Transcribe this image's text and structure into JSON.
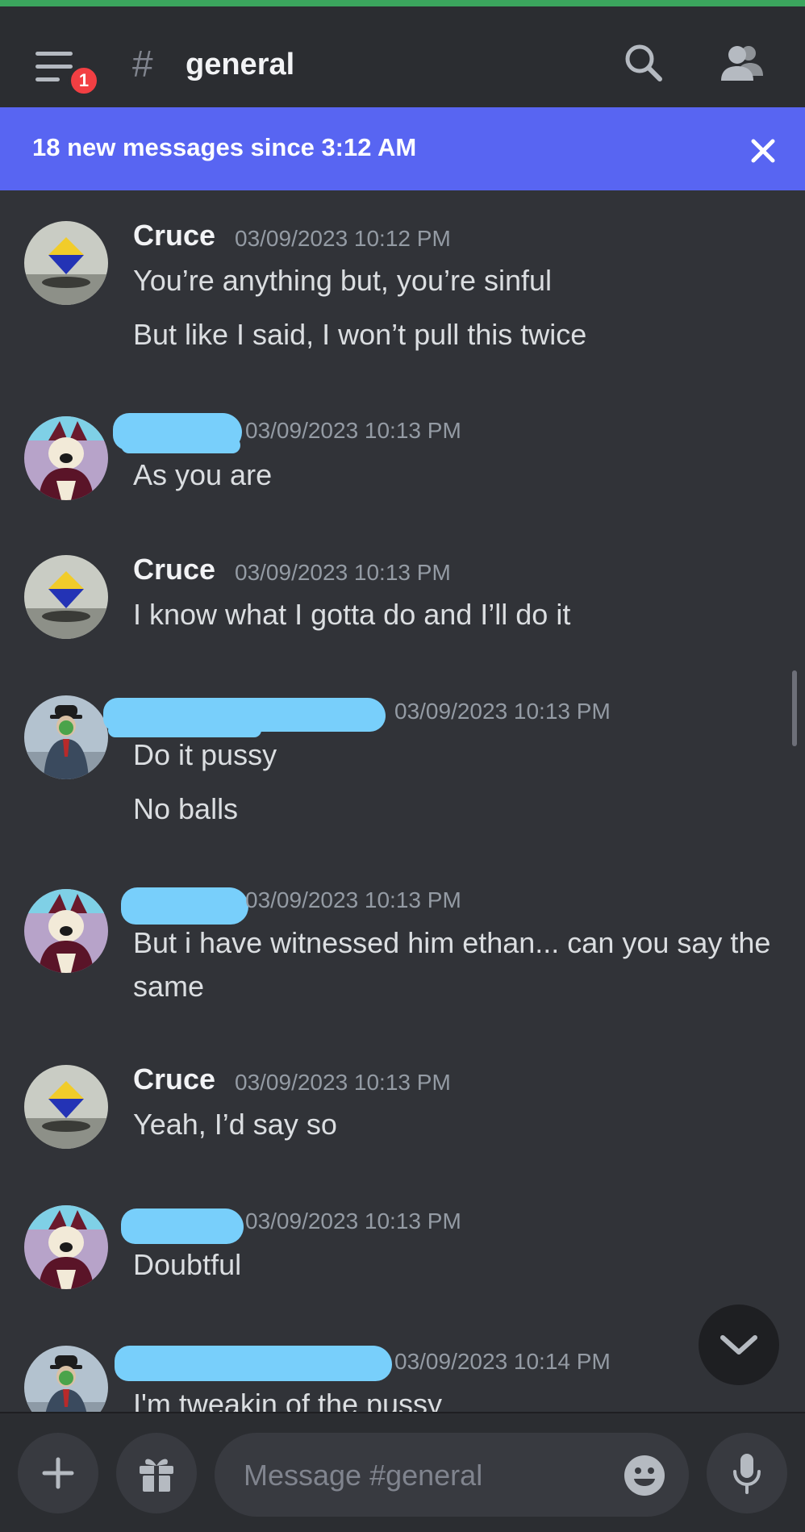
{
  "header": {
    "notification_count": "1",
    "channel_hash": "#",
    "channel_name": "general"
  },
  "banner": {
    "text": "18 new messages since 3:12 AM"
  },
  "messages": [
    {
      "author": "Cruce",
      "timestamp": "03/09/2023 10:12 PM",
      "lines": [
        "You’re anything but, you’re sinful",
        "But like I said, I won’t pull this twice"
      ]
    },
    {
      "author": "",
      "timestamp": "03/09/2023 10:13 PM",
      "lines": [
        "As you are"
      ]
    },
    {
      "author": "Cruce",
      "timestamp": "03/09/2023 10:13 PM",
      "lines": [
        "I know what I gotta do and I’ll do it"
      ]
    },
    {
      "author": "",
      "timestamp": "03/09/2023 10:13 PM",
      "lines": [
        "Do it pussy",
        "No balls"
      ]
    },
    {
      "author": "",
      "timestamp": "03/09/2023 10:13 PM",
      "lines": [
        "But i have witnessed him ethan... can you say the same"
      ]
    },
    {
      "author": "Cruce",
      "timestamp": "03/09/2023 10:13 PM",
      "lines": [
        "Yeah, I’d say so"
      ]
    },
    {
      "author": "",
      "timestamp": "03/09/2023 10:13 PM",
      "lines": [
        "Doubtful"
      ]
    },
    {
      "author": "",
      "timestamp": "03/09/2023 10:14 PM",
      "lines": [
        "I'm tweakin of the pussy"
      ]
    }
  ],
  "composer": {
    "placeholder": "Message #general"
  },
  "icons": {
    "menu": "menu-icon",
    "search": "search-icon",
    "members": "members-icon",
    "close": "close-icon",
    "jump": "chevron-down-icon",
    "add": "plus-icon",
    "gift": "gift-icon",
    "emoji": "emoji-icon",
    "mic": "microphone-icon"
  },
  "colors": {
    "background": "#313338",
    "header": "#2b2d31",
    "banner": "#5865f2",
    "badge": "#f23f43",
    "redaction": "#78cffb"
  }
}
